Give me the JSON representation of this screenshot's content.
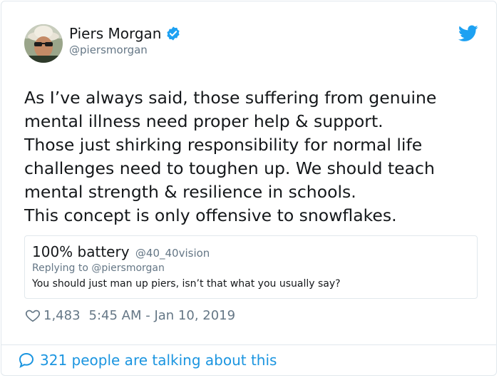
{
  "author": {
    "name": "Piers Morgan",
    "handle": "@piersmorgan",
    "verified": true,
    "avatar_icon": "avatar-photo"
  },
  "brand": {
    "icon": "twitter-bird-icon",
    "color": "#1da1f2"
  },
  "tweet": {
    "lines": [
      "As I’ve always said, those suffering from genuine",
      "mental illness need proper help & support.",
      "Those just shirking responsibility for normal life",
      "challenges need to toughen up. We should teach",
      "mental strength & resilience in schools.",
      "This concept is only offensive to snowflakes."
    ]
  },
  "quote": {
    "name": "100% battery",
    "handle": "@40_40vision",
    "replying_to": "Replying to @piersmorgan",
    "text": "You should just man up piers, isn’t that what you usually say?"
  },
  "meta": {
    "likes": "1,483",
    "timestamp": "5:45 AM - Jan 10, 2019"
  },
  "footer": {
    "talking_label": "321 people are talking about this",
    "link_color": "#1b95e0"
  }
}
